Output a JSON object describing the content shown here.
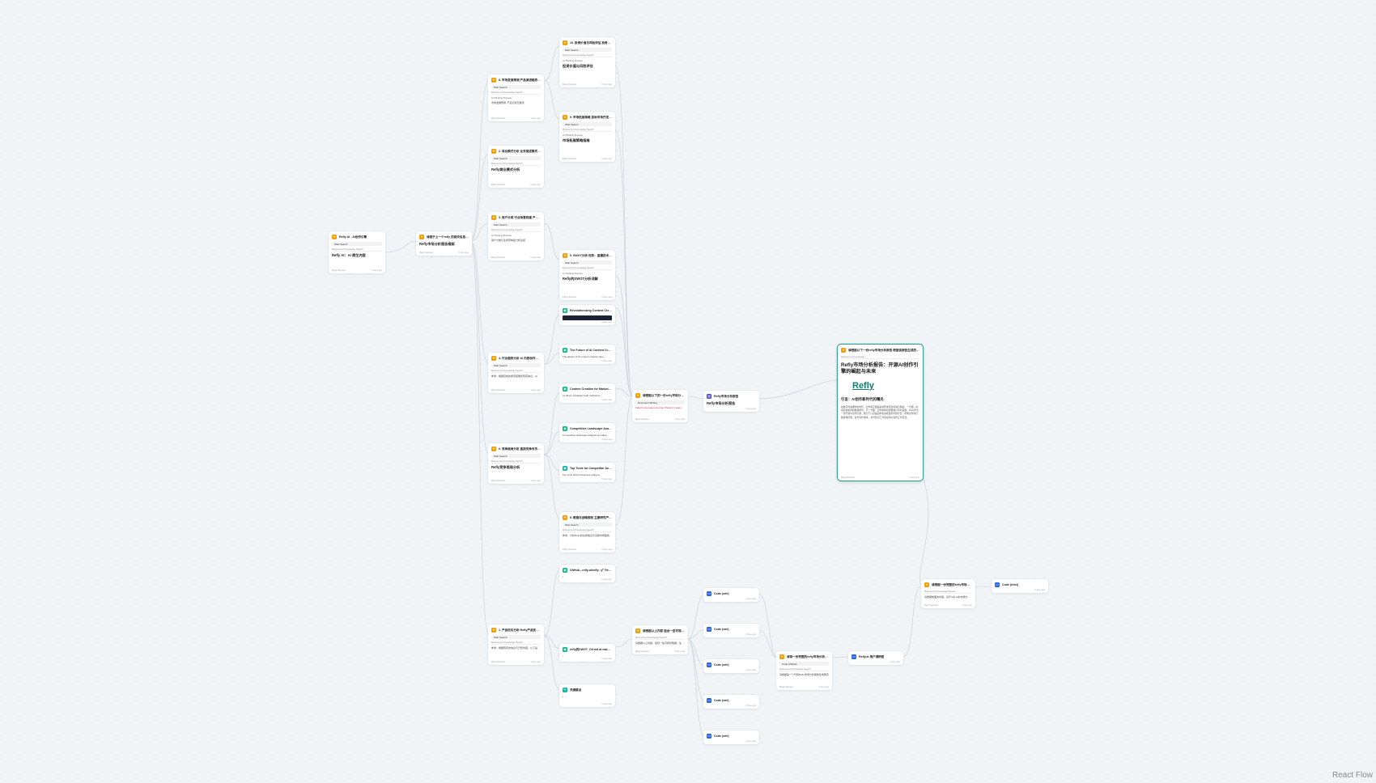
{
  "watermark": "React Flow",
  "common": {
    "web_search": "Web Search",
    "refs": "Referenced Knowledge Search",
    "thinking": "AI Thinking Process",
    "meta": "Reply Sources",
    "timestamp": "3 days ago"
  },
  "nodes": {
    "n_root": {
      "title": "Refly AI - AI创作引擎",
      "heading": "Refly AI：AI 原生内容"
    },
    "n_frame": {
      "title": "请基于上一个refly 的相关信息…",
      "heading": "Refly市场分析报告框架"
    },
    "n_policy_bg": {
      "title": "8. 市场发展预测 产品演进趋势 …",
      "heading": "市场发展预测: 产品分析及展望"
    },
    "n_business": {
      "title": "2. 商业模式分析 业务描述模式 （优…",
      "heading": "Refly商业模式分析"
    },
    "n_user": {
      "title": "3. 用户分类 行业场景构建 产品分…",
      "heading": "用户分类行业场景构建分析总结"
    },
    "n_industry": {
      "title": "4. 行业趋势分析 AI 内容创作工具…",
      "text": "参考：根据目前的搜索结果和现有信息，以下是…"
    },
    "n_compete": {
      "title": "6. 竞争格局分析 直接竞争对手 …",
      "heading": "Refly竞争格局分析"
    },
    "n_product": {
      "title": "1. 产品优劣分析 Refly产品优势…",
      "text": "参考：根据现有的信息与已知内容，以下是对Refly…"
    },
    "n_risk": {
      "title": "10. 投资价值与风险评估 投资吸引力…",
      "heading": "投资价值与风险评估"
    },
    "n_market_exp": {
      "title": "9. 市场拓展策略 目标市场开发战略…",
      "heading": "市场拓展策略指南"
    },
    "n_swot": {
      "title": "5. SWOT分析 优势：直播技术…",
      "heading": "Refly的SWOT分析详解"
    },
    "n_res1": {
      "title": "Revolutionizing Content Creati…"
    },
    "n_res2": {
      "title": "The Future of AI Content Creati…",
      "text": "The advent of AI content creation has r…"
    },
    "n_res3": {
      "title": "Content Creation for Marketers…",
      "text": "AI-driven strategies help marketers…"
    },
    "n_res4": {
      "title": "Competitive Landscape Analy…",
      "text": "Competitive landscape analysis provides…"
    },
    "n_res5": {
      "title": "Top Tools for Competitor Anal…",
      "text": "Top tools help businesses analyze…"
    },
    "n_future": {
      "title": "8. 数据与战略规划 主要研究产品发展…",
      "text": "参考：分析Refly的关键信息与当前市场趋势，以下…"
    },
    "n_github": {
      "title": "GitHub - refly-ai/refly: 🚀 Refly…",
      "text": "⁝"
    },
    "n_wiki": {
      "title": "refly的SWOT_Oil.md at main …",
      "text": "⁝"
    },
    "n_memo": {
      "title": "关键要点",
      "text": "• …"
    },
    "n_generate": {
      "title": "请根据以下的一份refly市场分析报告…",
      "chip": "Document Writing",
      "error": "Failed to generate response. Please try again."
    },
    "n_report_doc": {
      "title": "Refly市场分析报告",
      "heading": "Refly市场分析报告"
    },
    "n_selected": {
      "title": "请根据以下一份refly市场分析报告 根据该报告生成的 所引导…",
      "ref": "Referenced Knowledge",
      "heading": "Refly市场分析报告：开源AI创作引擎的崛起与未来",
      "logo": "Refly",
      "section": "引言：AI创作新时代的曙光",
      "para": "在数字内容爆炸的时代，创作者正面临着前所未有的机遇与挑战。一方面，内容需求呈现指数级增长；另一方面，创作效率和质量难以同时兼顾。Refly作为一款开源AI创作引擎，致力于以自由画布和多模型协同的方式，帮助创作者打破思维局限、提升创作效率，并为知识工作者提供全新的工作范式。"
    },
    "n_plan": {
      "title": "请根据以上内容 结合一些可视化数据…",
      "text": "请根据以上内容，结合一些可视化数据，生成网页…"
    },
    "n_code1": {
      "title": "Code (xml)"
    },
    "n_code2": {
      "title": "Code (xml)"
    },
    "n_code3": {
      "title": "Code (xml)"
    },
    "n_code4": {
      "title": "Code (xml)"
    },
    "n_code5": {
      "title": "Code (xml)"
    },
    "n_summarize": {
      "title": "请将一份完整的refly市场分析报告整理…",
      "chip": "Code Artifacts",
      "text": "请根据第一个代码Refly市场分析报告生成网页"
    },
    "n_artifact": {
      "title": "Refly.ai 用户调研图"
    },
    "n_final": {
      "title": "请根据一份完整的refly市场分析报告…",
      "text": "请根据前面的内容，基于refly.ai的市场分析报告，生成…"
    },
    "n_code_final": {
      "title": "Code (html)"
    }
  }
}
